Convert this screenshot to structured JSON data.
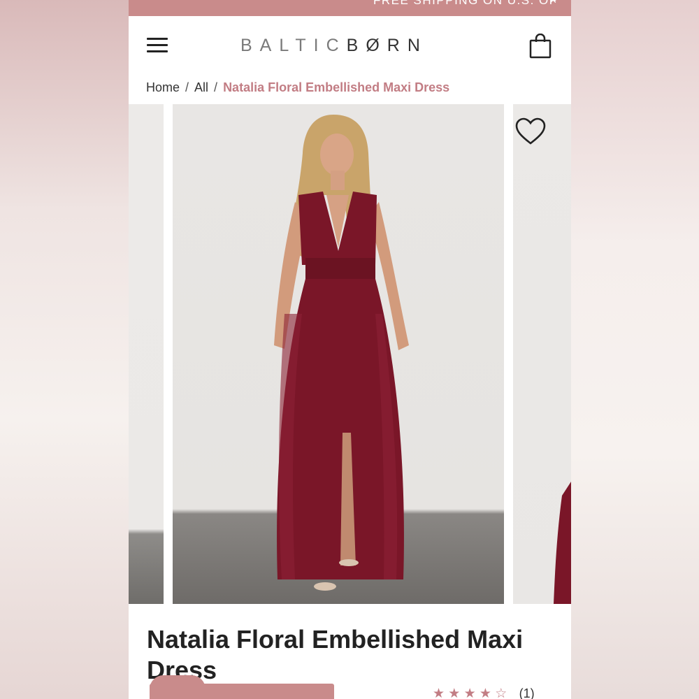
{
  "promo": {
    "text": "FREE SHIPPING ON U.S. OF",
    "close_icon": "×"
  },
  "header": {
    "logo_light": "BALTIC",
    "logo_dark": "BØRN"
  },
  "breadcrumb": {
    "items": [
      "Home",
      "All"
    ],
    "separator": "/",
    "current": "Natalia Floral Embellished Maxi Dress"
  },
  "product": {
    "title": "Natalia Floral Embellished Maxi Dress",
    "rating": {
      "stars": 4,
      "max": 5,
      "count": "(1)",
      "filled_glyphs": "★ ★ ★ ★",
      "empty_glyph": "☆"
    }
  },
  "colors": {
    "accent": "#c98b8b",
    "breadcrumb_current": "#c27d84",
    "dress": "#7a1628"
  }
}
